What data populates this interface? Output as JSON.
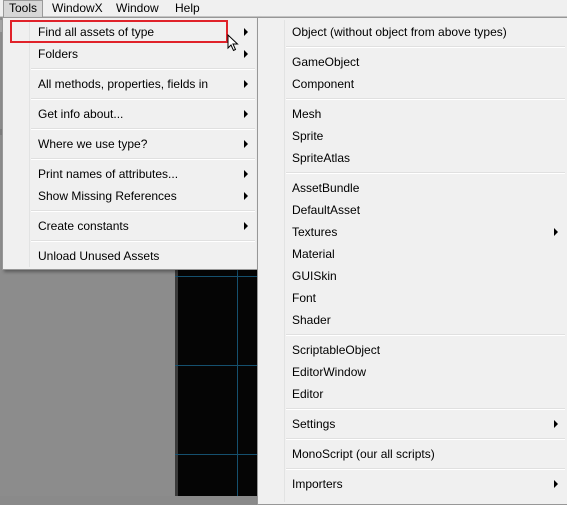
{
  "menubar": {
    "items": [
      {
        "label": "Tools",
        "open": true
      },
      {
        "label": "WindowX"
      },
      {
        "label": "Window"
      },
      {
        "label": "Help"
      }
    ]
  },
  "tools_menu": {
    "items": [
      {
        "label": "Find all assets of type",
        "submenu": true,
        "highlighted": true
      },
      {
        "label": "Folders",
        "submenu": true
      },
      {
        "label": "All methods, properties, fields in",
        "submenu": true
      },
      {
        "label": "Get info about...",
        "submenu": true
      },
      {
        "label": "Where we use type?",
        "submenu": true
      },
      {
        "label": "Print names of attributes...",
        "submenu": true
      },
      {
        "label": "Show Missing References",
        "submenu": true
      },
      {
        "label": "Create constants",
        "submenu": true
      },
      {
        "label": "Unload Unused Assets",
        "submenu": false
      }
    ]
  },
  "asset_type_submenu": {
    "items": [
      {
        "label": "Object (without object from above types)"
      },
      {
        "label": "GameObject"
      },
      {
        "label": "Component"
      },
      {
        "label": "Mesh"
      },
      {
        "label": "Sprite"
      },
      {
        "label": "SpriteAtlas"
      },
      {
        "label": "AssetBundle"
      },
      {
        "label": "DefaultAsset"
      },
      {
        "label": "Textures",
        "submenu": true
      },
      {
        "label": "Material"
      },
      {
        "label": "GUISkin"
      },
      {
        "label": "Font"
      },
      {
        "label": "Shader"
      },
      {
        "label": "ScriptableObject"
      },
      {
        "label": "EditorWindow"
      },
      {
        "label": "Editor"
      },
      {
        "label": "Settings",
        "submenu": true
      },
      {
        "label": "MonoScript (our all scripts)"
      },
      {
        "label": "Importers",
        "submenu": true
      }
    ]
  },
  "colors": {
    "menu_bg": "#f0f0f0",
    "highlight_border": "#e0222a",
    "scene_grid": "#15506e"
  }
}
